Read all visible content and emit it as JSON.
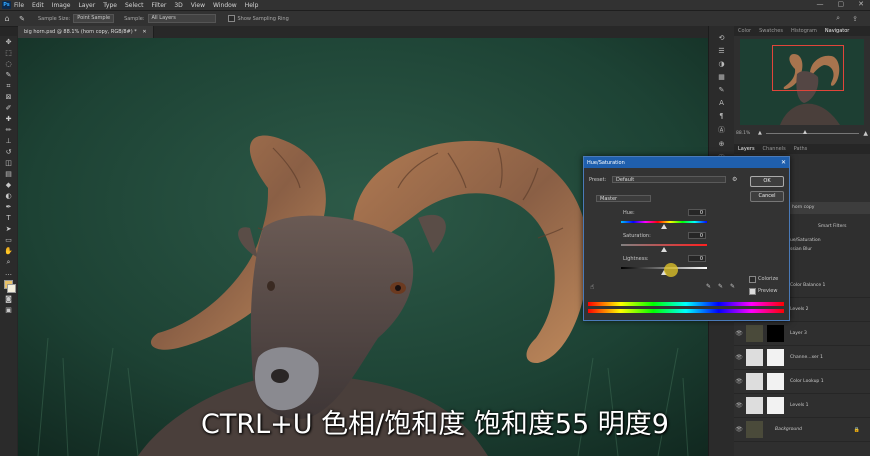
{
  "menubar": {
    "logo": "Ps",
    "items": [
      "File",
      "Edit",
      "Image",
      "Layer",
      "Type",
      "Select",
      "Filter",
      "3D",
      "View",
      "Window",
      "Help"
    ],
    "controls": [
      "—",
      "▢",
      "✕"
    ]
  },
  "options_bar": {
    "sample_size_label": "Sample Size:",
    "sample_size_value": "Point Sample",
    "sample_label": "Sample:",
    "sample_value": "All Layers",
    "show_ring_label": "Show Sampling Ring"
  },
  "document_tab": {
    "label": "big horn.psd @ 88.1% (horn copy, RGB/8#) *"
  },
  "right_panel": {
    "top_tabs": [
      "Color",
      "Swatches",
      "Histogram",
      "Navigator"
    ],
    "active_top_tab": "Navigator",
    "zoom_readout": "88.1%",
    "layer_tabs": [
      "Layers",
      "Channels",
      "Paths"
    ],
    "active_layer_tab": "Layers",
    "partial_layer_texts": {
      "horn_copy": "horn copy",
      "smart_filters": "Smart Filters",
      "hue_sat_filter": "ue/Saturation",
      "blur_filter": "ssian Blur"
    },
    "layers": [
      {
        "name": "Color Balance 1",
        "mask": "white"
      },
      {
        "name": "Levels 2",
        "mask": "white"
      },
      {
        "name": "Layer 3",
        "mask": "black"
      },
      {
        "name": "Channe...xer 1",
        "mask": "white"
      },
      {
        "name": "Color Lookup 1",
        "mask": "white"
      },
      {
        "name": "Levels 1",
        "mask": "white"
      },
      {
        "name": "Background",
        "mask": "none"
      }
    ]
  },
  "hue_saturation_dialog": {
    "title": "Hue/Saturation",
    "preset_label": "Preset:",
    "preset_value": "Default",
    "channel_value": "Master",
    "hue_label": "Hue:",
    "hue_value": "0",
    "saturation_label": "Saturation:",
    "saturation_value": "0",
    "lightness_label": "Lightness:",
    "lightness_value": "0",
    "ok_label": "OK",
    "cancel_label": "Cancel",
    "colorize_label": "Colorize",
    "colorize_checked": false,
    "preview_label": "Preview",
    "preview_checked": true,
    "hue_level_fraction": 0.5,
    "saturation_level_fraction": 0.5,
    "lightness_level_fraction": 0.5
  },
  "subtitle": {
    "text": "CTRL+U 色相/饱和度 饱和度55 明度9"
  },
  "colors": {
    "dialog_title_blue": "#1f5fad",
    "navigator_frame": "#e0453a",
    "panel_bg": "#2f2f2f"
  }
}
